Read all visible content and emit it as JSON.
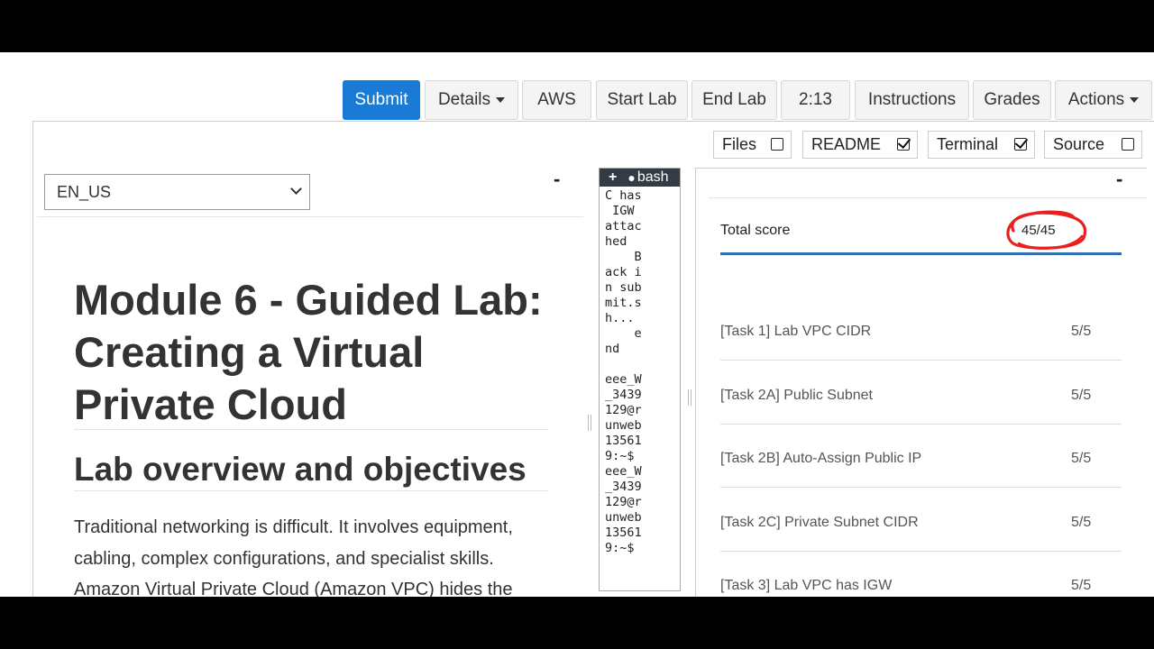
{
  "toolbar": {
    "submit": "Submit",
    "details": "Details",
    "aws": "AWS",
    "start_lab": "Start Lab",
    "end_lab": "End Lab",
    "timer": "2:13",
    "instructions": "Instructions",
    "grades": "Grades",
    "actions": "Actions"
  },
  "toggles": {
    "files": {
      "label": "Files",
      "checked": false
    },
    "readme": {
      "label": "README",
      "checked": true
    },
    "terminal": {
      "label": "Terminal",
      "checked": true
    },
    "source": {
      "label": "Source",
      "checked": false
    }
  },
  "readme": {
    "language": "EN_US",
    "collapse": "-",
    "title": "Module 6 - Guided Lab: Creating a Virtual Private Cloud",
    "section": "Lab overview and objectives",
    "body": "Traditional networking is difficult. It involves equipment, cabling, complex configurations, and specialist skills. Amazon Virtual Private Cloud (Amazon VPC) hides the"
  },
  "terminal": {
    "add": "+",
    "tab_name": "bash",
    "lines": [
      "C has",
      " IGW",
      "attac",
      "hed",
      "    B",
      "ack i",
      "n sub",
      "mit.s",
      "h...",
      "    e",
      "nd",
      "",
      "eee_W",
      "_3439",
      "129@r",
      "unweb",
      "13561",
      "9:~$",
      "eee_W",
      "_3439",
      "129@r",
      "unweb",
      "13561",
      "9:~$"
    ]
  },
  "grades": {
    "collapse": "-",
    "total_label": "Total score",
    "total_value": "45/45",
    "tasks": [
      {
        "label": "[Task 1] Lab VPC CIDR",
        "score": "5/5"
      },
      {
        "label": "[Task 2A] Public Subnet",
        "score": "5/5"
      },
      {
        "label": "[Task 2B] Auto-Assign Public IP",
        "score": "5/5"
      },
      {
        "label": "[Task 2C] Private Subnet CIDR",
        "score": "5/5"
      },
      {
        "label": "[Task 3] Lab VPC has IGW",
        "score": "5/5"
      }
    ]
  },
  "colors": {
    "primary": "#1a7bd6",
    "total_line": "#2e6fad",
    "annotation": "#e8201e"
  }
}
